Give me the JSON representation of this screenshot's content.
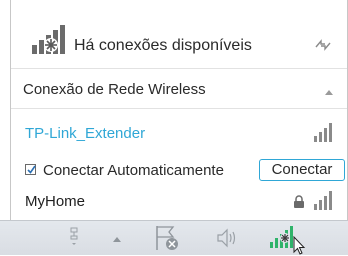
{
  "header": {
    "title": "Há conexões disponíveis",
    "network_icon": "network-icon",
    "refresh_icon": "refresh-icon"
  },
  "section": {
    "label": "Conexão de Rede Wireless",
    "collapse_icon": "caret-up-icon"
  },
  "networks": [
    {
      "name": "TP-Link_Extender",
      "selected": true,
      "secured": false,
      "signal_icon": "signal-bars-icon"
    },
    {
      "name": "MyHome",
      "selected": false,
      "secured": true,
      "signal_icon": "signal-bars-icon"
    }
  ],
  "auto_connect": {
    "label": "Conectar Automaticamente",
    "checked": true
  },
  "connect_button": {
    "label": "Conectar"
  },
  "taskbar": {
    "icons": [
      "network-cables-icon",
      "show-hidden-icons-icon",
      "flag-icon",
      "speaker-icon",
      "wifi-tray-icon"
    ]
  },
  "colors": {
    "accent": "#2fa7d6",
    "text": "#2a2a2a",
    "taskbar": "#dde1e6"
  }
}
